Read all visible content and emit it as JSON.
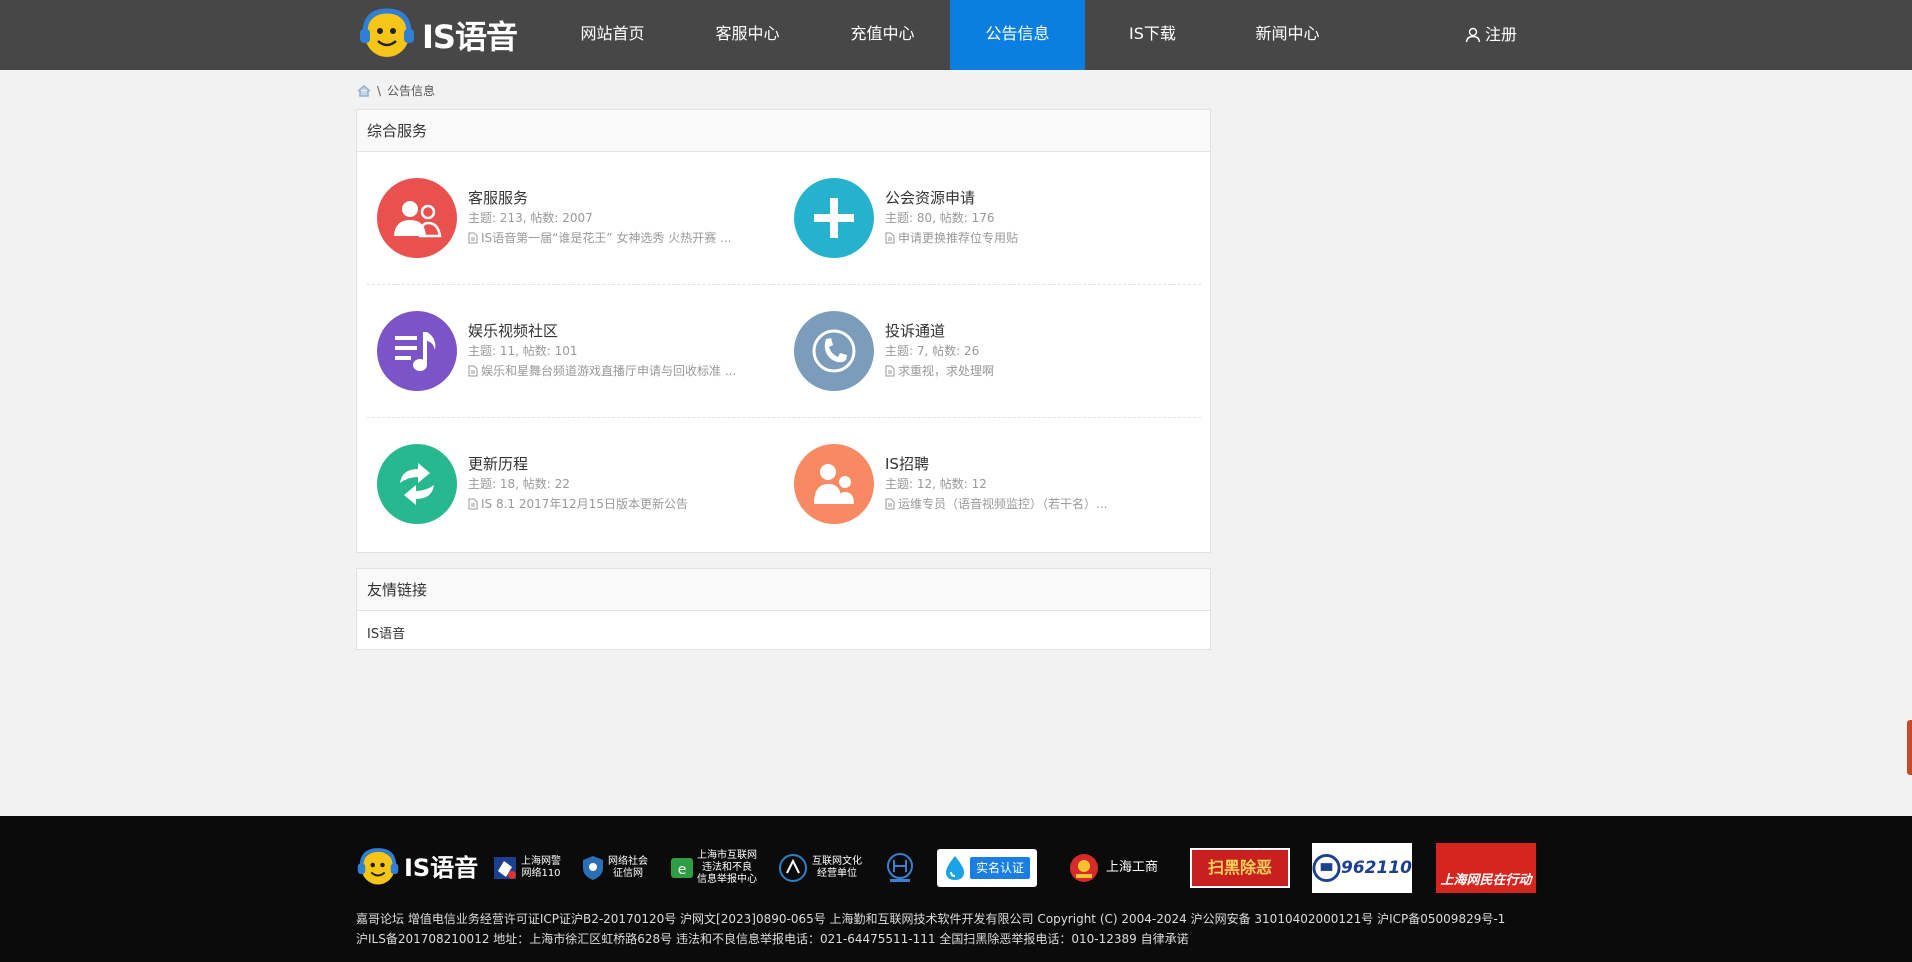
{
  "header": {
    "logo_text": "IS语音",
    "nav": [
      "网站首页",
      "客服中心",
      "充值中心",
      "公告信息",
      "IS下载",
      "新闻中心"
    ],
    "active_index": 3,
    "register": "注册"
  },
  "breadcrumb": {
    "current": "公告信息",
    "separator": "\\"
  },
  "services": {
    "title": "综合服务",
    "items": [
      {
        "title": "客服服务",
        "stats": "主题: 213, 帖数: 2007",
        "latest": "IS语音第一届“谁是花王” 女神选秀 火热开赛 ...",
        "color": "#e9514f",
        "icon": "users-icon"
      },
      {
        "title": "公会资源申请",
        "stats": "主题: 80, 帖数: 176",
        "latest": "申请更换推荐位专用贴",
        "color": "#26b2cc",
        "icon": "plus-icon"
      },
      {
        "title": "娱乐视频社区",
        "stats": "主题: 11, 帖数: 101",
        "latest": "娱乐和星舞台频道游戏直播厅申请与回收标准 ...",
        "color": "#7b54c7",
        "icon": "music-icon"
      },
      {
        "title": "投诉通道",
        "stats": "主题: 7, 帖数: 26",
        "latest": "求重视，求处理啊",
        "color": "#7b9cbb",
        "icon": "phone-icon"
      },
      {
        "title": "更新历程",
        "stats": "主题: 18, 帖数: 22",
        "latest": "IS 8.1 2017年12月15日版本更新公告",
        "color": "#27b88f",
        "icon": "refresh-icon"
      },
      {
        "title": "IS招聘",
        "stats": "主题: 12, 帖数: 12",
        "latest": "运维专员（语音视频监控）（若干名）...",
        "color": "#f78a62",
        "icon": "people-icon"
      }
    ]
  },
  "links": {
    "title": "友情链接",
    "items": [
      "IS语音"
    ]
  },
  "footer": {
    "logo_text": "IS语音",
    "badges": {
      "police": [
        "上海网警",
        "网络110"
      ],
      "credit": [
        "网络社会",
        "征信网"
      ],
      "report": [
        "上海市互联网",
        "违法和不良",
        "信息举报中心"
      ],
      "culture": [
        "互联网文化",
        "经营单位"
      ],
      "realname": "实名认证",
      "gongshang": "上海工商",
      "img1": "扫黑除恶",
      "img2": "962110",
      "img3": "上海网民在行动"
    },
    "line1": "嘉哥论坛   增值电信业务经营许可证ICP证沪B2-20170120号   沪网文[2023]0890-065号   上海勤和互联网技术软件开发有限公司 Copyright (C) 2004-2024   沪公网安备 31010402000121号   沪ICP备05009829号-1",
    "line2": "沪ILS备201708210012   地址：上海市徐汇区虹桥路628号   违法和不良信息举报电话：021-64475511-111   全国扫黑除恶举报电话：010-12389   自律承诺"
  }
}
